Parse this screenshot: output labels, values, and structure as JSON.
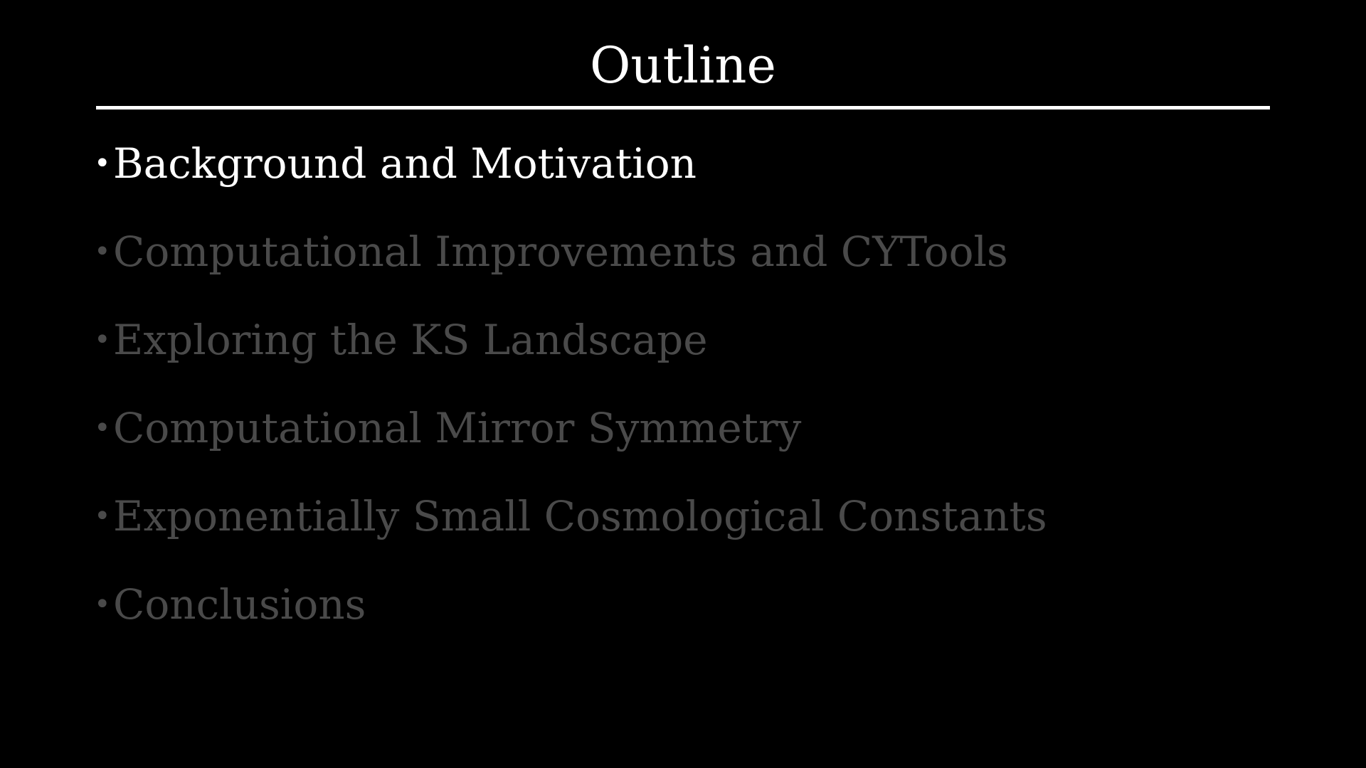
{
  "slide": {
    "title": "Outline",
    "bullet_glyph": "•",
    "items": [
      {
        "label": "Background and Motivation",
        "state": "active"
      },
      {
        "label": "Computational Improvements and CYTools",
        "state": "dim"
      },
      {
        "label": "Exploring the KS Landscape",
        "state": "dim"
      },
      {
        "label": "Computational Mirror Symmetry",
        "state": "dim"
      },
      {
        "label": "Exponentially Small Cosmological Constants",
        "state": "dim"
      },
      {
        "label": "Conclusions",
        "state": "dim"
      }
    ]
  },
  "colors": {
    "background": "#000000",
    "active_text": "#ffffff",
    "dim_text": "#4a4a4a",
    "rule": "#ffffff"
  }
}
